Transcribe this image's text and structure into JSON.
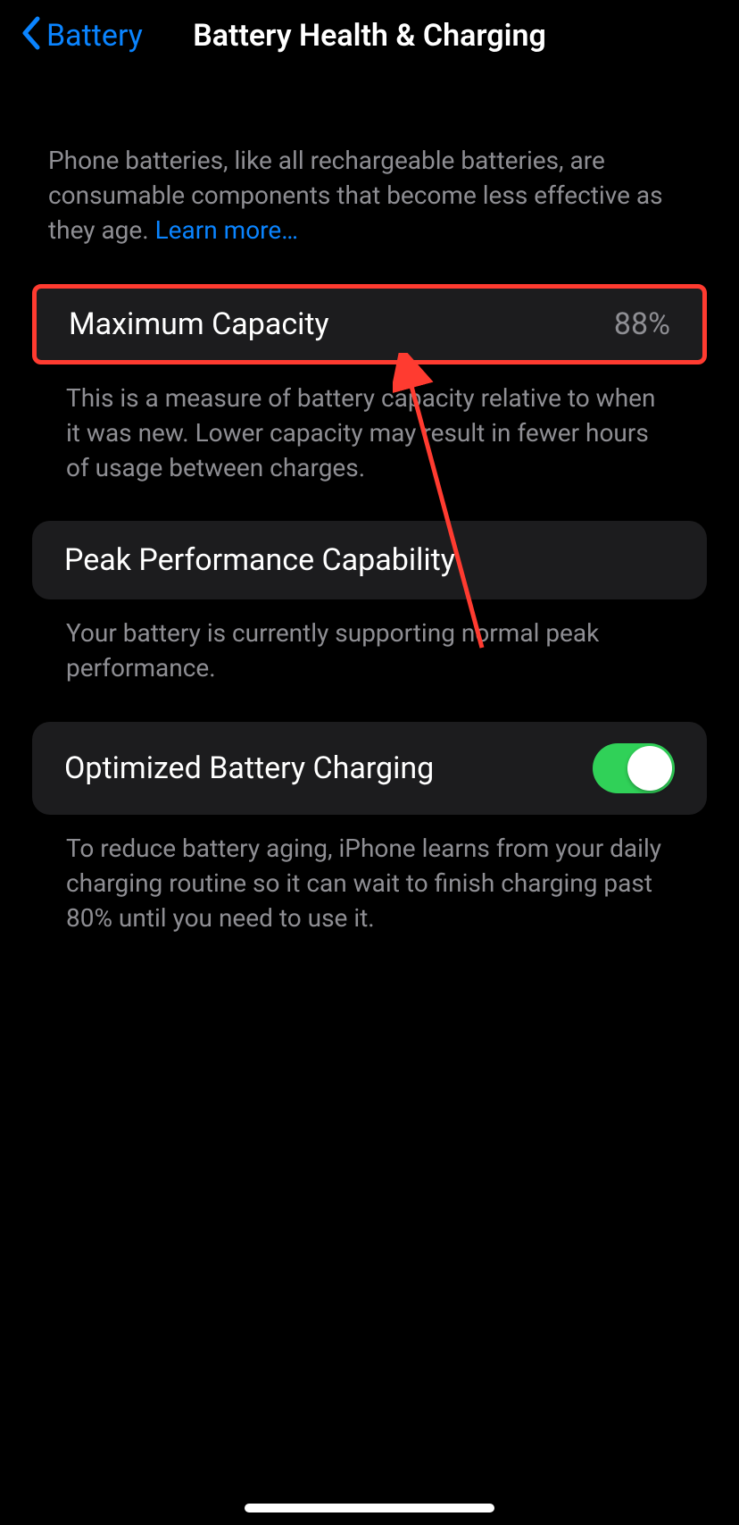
{
  "nav": {
    "back_label": "Battery",
    "title": "Battery Health & Charging"
  },
  "intro": {
    "text": "Phone batteries, like all rechargeable batteries, are consumable components that become less effective as they age. ",
    "learn_more": "Learn more…"
  },
  "sections": {
    "max_capacity": {
      "label": "Maximum Capacity",
      "value": "88%",
      "footer": "This is a measure of battery capacity relative to when it was new. Lower capacity may result in fewer hours of usage between charges."
    },
    "peak_performance": {
      "label": "Peak Performance Capability",
      "footer": "Your battery is currently supporting normal peak performance."
    },
    "optimized_charging": {
      "label": "Optimized Battery Charging",
      "enabled": true,
      "footer": "To reduce battery aging, iPhone learns from your daily charging routine so it can wait to finish charging past 80% until you need to use it."
    }
  }
}
